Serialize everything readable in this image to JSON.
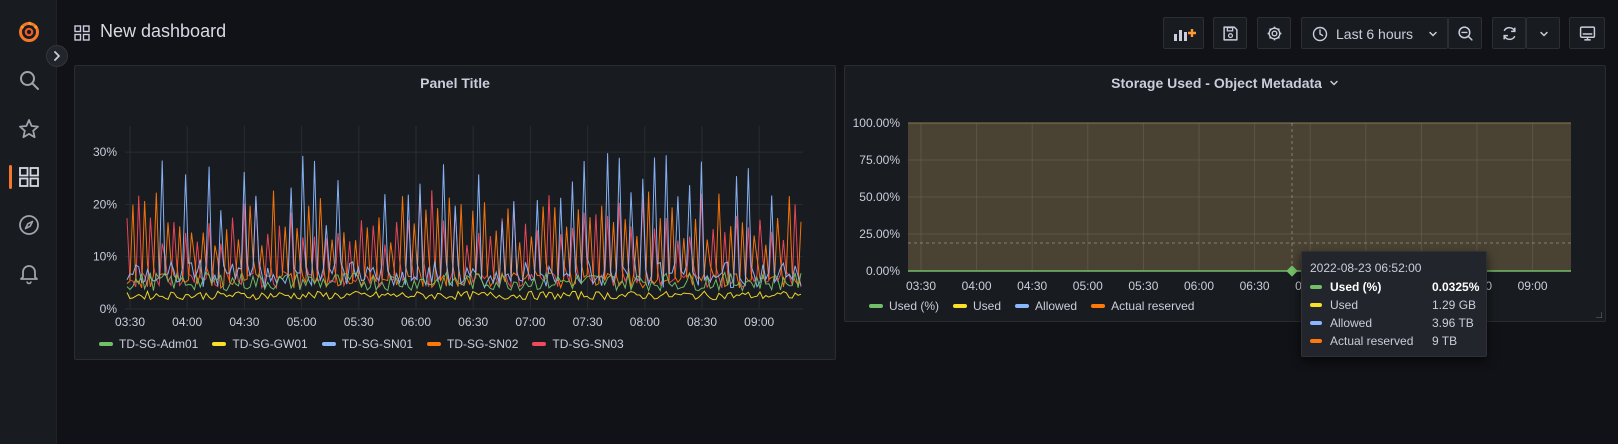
{
  "header": {
    "title": "New dashboard",
    "time_range_label": "Last 6 hours"
  },
  "icons": {
    "logo": "grafana-logo-icon",
    "search": "search-icon",
    "starred": "star-icon",
    "dashboards": "dashboards-grid-icon",
    "explore": "compass-icon",
    "alerting": "bell-icon",
    "add_panel": "add-panel-icon",
    "save": "save-icon",
    "settings": "gear-icon",
    "clock": "clock-icon",
    "zoom_out": "zoom-out-icon",
    "refresh": "refresh-icon",
    "tv_mode": "monitor-icon"
  },
  "colors": {
    "accent": "#f5772b",
    "green": "#73bf69",
    "yellow": "#fade2a",
    "blue": "#8ab8ff",
    "orange": "#ff780a",
    "red": "#f2495c"
  },
  "panel1": {
    "title": "Panel Title",
    "legend": [
      "TD-SG-Adm01",
      "TD-SG-GW01",
      "TD-SG-SN01",
      "TD-SG-SN02",
      "TD-SG-SN03"
    ]
  },
  "panel2": {
    "title": "Storage Used - Object Metadata",
    "legend": [
      "Used (%)",
      "Used",
      "Allowed",
      "Actual reserved"
    ]
  },
  "tooltip": {
    "date": "2022-08-23 06:52:00",
    "rows": [
      {
        "name": "Used (%)",
        "value": "0.0325%"
      },
      {
        "name": "Used",
        "value": "1.29 GB"
      },
      {
        "name": "Allowed",
        "value": "3.96 TB"
      },
      {
        "name": "Actual reserved",
        "value": "9 TB"
      }
    ]
  },
  "chart_data": [
    {
      "type": "line",
      "title": "Panel Title",
      "x_ticks": [
        "03:30",
        "04:00",
        "04:30",
        "05:00",
        "05:30",
        "06:00",
        "06:30",
        "07:00",
        "07:30",
        "08:00",
        "08:30",
        "09:00"
      ],
      "y_ticks": [
        "0%",
        "10%",
        "20%",
        "30%"
      ],
      "ylim": [
        0,
        35
      ],
      "grid": true,
      "legend_position": "bottom-left",
      "series": [
        {
          "name": "TD-SG-Adm01",
          "color": "#73bf69",
          "approx_range": [
            3,
            7
          ]
        },
        {
          "name": "TD-SG-GW01",
          "color": "#fade2a",
          "approx_range": [
            1.5,
            3.5
          ]
        },
        {
          "name": "TD-SG-SN01",
          "color": "#8ab8ff",
          "approx_range": [
            4,
            31
          ]
        },
        {
          "name": "TD-SG-SN02",
          "color": "#ff780a",
          "approx_range": [
            4,
            24
          ]
        },
        {
          "name": "TD-SG-SN03",
          "color": "#f2495c",
          "approx_range": [
            4,
            24
          ]
        }
      ]
    },
    {
      "type": "area",
      "title": "Storage Used - Object Metadata",
      "x_ticks": [
        "03:30",
        "04:00",
        "04:30",
        "05:00",
        "05:30",
        "06:00",
        "06:30",
        "07:00",
        "07:30",
        "08:00",
        "08:30",
        "09:00"
      ],
      "y_ticks": [
        "0.00%",
        "25.00%",
        "50.00%",
        "75.00%",
        "100.00%"
      ],
      "ylim": [
        0,
        100
      ],
      "grid": true,
      "legend_position": "bottom-left",
      "series": [
        {
          "name": "Used (%)",
          "color": "#73bf69",
          "values": [
            0.0325
          ]
        },
        {
          "name": "Used",
          "color": "#fade2a"
        },
        {
          "name": "Allowed",
          "color": "#8ab8ff"
        },
        {
          "name": "Actual reserved",
          "color": "#ff780a",
          "values": [
            100
          ]
        }
      ]
    }
  ]
}
